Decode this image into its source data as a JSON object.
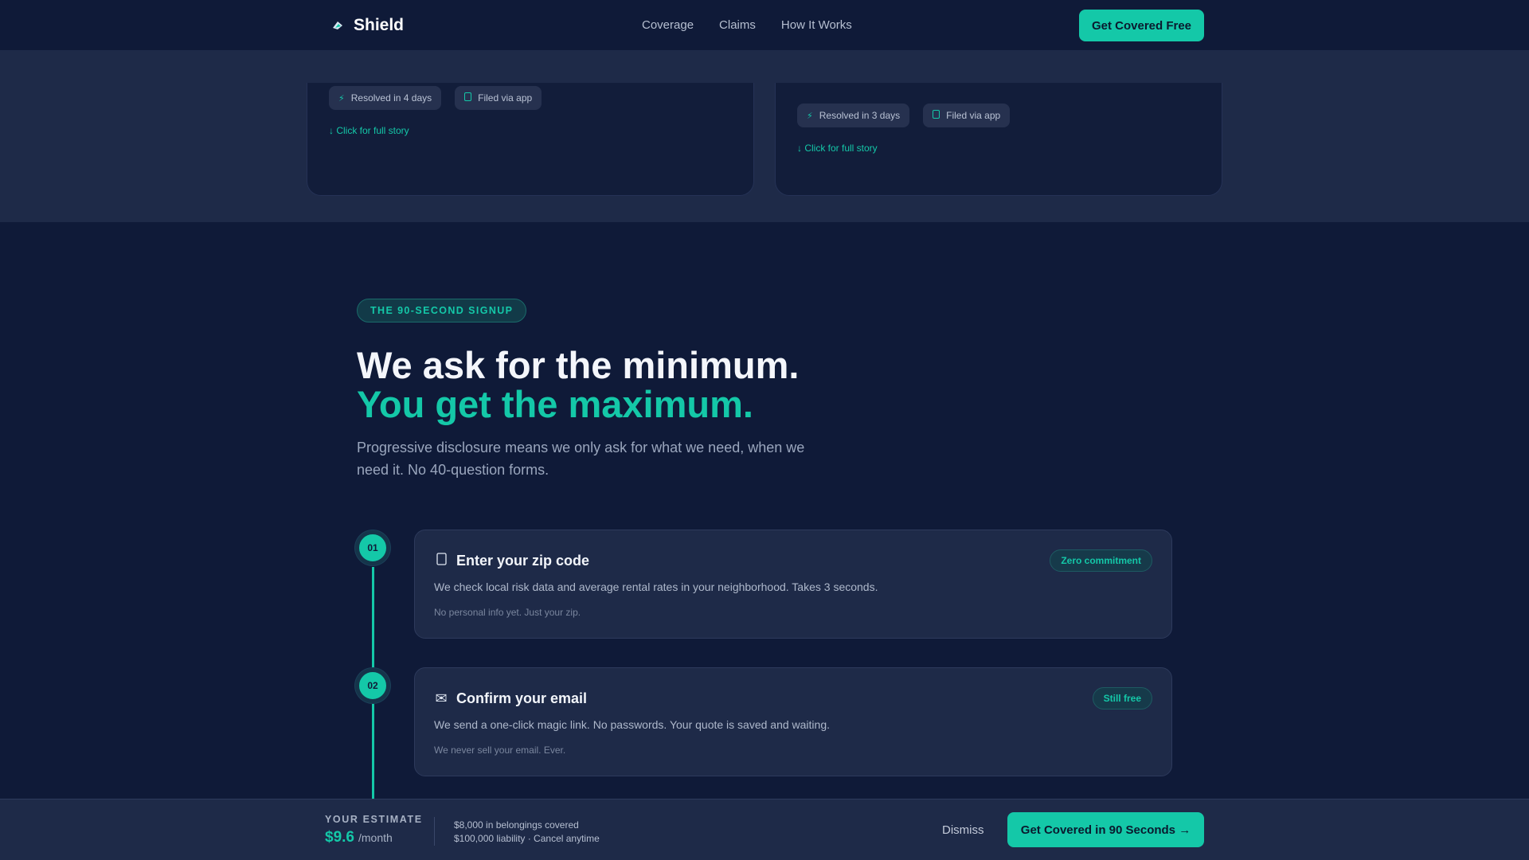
{
  "header": {
    "brand": "Shield",
    "nav": [
      "Coverage",
      "Claims",
      "How It Works"
    ],
    "cta": "Get Covered Free"
  },
  "stories": [
    {
      "badges": [
        {
          "icon": "lightning-icon",
          "label": "Resolved in 4 days"
        },
        {
          "icon": "phone-icon",
          "label": "Filed via app"
        }
      ],
      "link": "↓ Click for full story"
    },
    {
      "badges": [
        {
          "icon": "lightning-icon",
          "label": "Resolved in 3 days"
        },
        {
          "icon": "phone-icon",
          "label": "Filed via app"
        }
      ],
      "link": "↓ Click for full story"
    }
  ],
  "signup": {
    "eyebrow": "THE 90-SECOND SIGNUP",
    "headline_1": "We ask for the minimum.",
    "headline_2": "You get the maximum.",
    "lead": "Progressive disclosure means we only ask for what we need, when we need it. No 40-question forms.",
    "steps": [
      {
        "number": "01",
        "icon": "location-icon",
        "title": "Enter your zip code",
        "desc": "We check local risk data and average rental rates in your neighborhood. Takes 3 seconds.",
        "note": "No personal info yet. Just your zip.",
        "pill": "Zero commitment"
      },
      {
        "number": "02",
        "icon": "envelope-icon",
        "title": "Confirm your email",
        "desc": "We send a one-click magic link. No passwords. Your quote is saved and waiting.",
        "note": "We never sell your email. Ever.",
        "pill": "Still free"
      }
    ]
  },
  "estimate_bar": {
    "label": "YOUR ESTIMATE",
    "price": "$9.6",
    "unit": "/month",
    "line_1": "$8,000 in belongings covered",
    "line_2": "$100,000 liability · Cancel anytime",
    "dismiss": "Dismiss",
    "cta": "Get Covered in 90 Seconds →"
  },
  "colors": {
    "accent": "#14c8a8",
    "background": "#0f1a38",
    "card": "#1e2a48"
  }
}
